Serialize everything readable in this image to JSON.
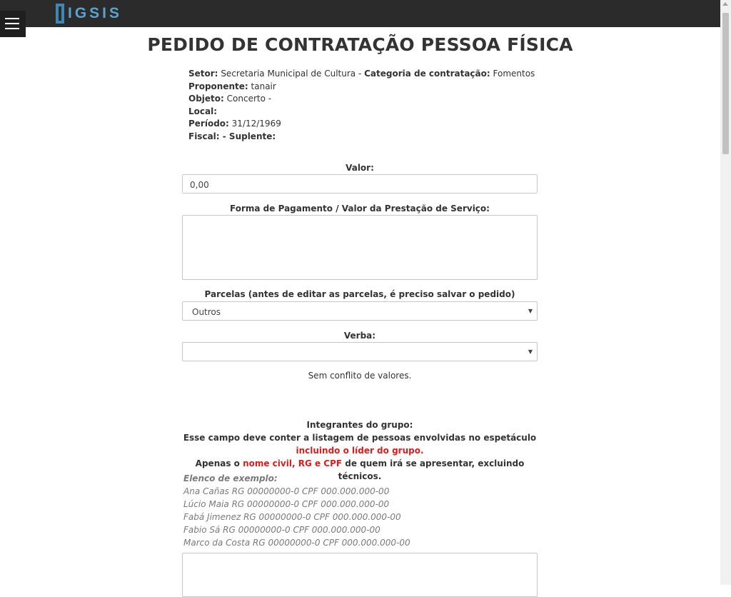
{
  "header": {
    "logo_text": "IGSIS"
  },
  "page": {
    "title": "PEDIDO DE CONTRATAÇÃO PESSOA FÍSICA"
  },
  "info": {
    "setor_label": "Setor:",
    "setor_value": "Secretaria Municipal de Cultura - ",
    "categoria_label": "Categoria de contratação:",
    "categoria_value": "Fomentos",
    "proponente_label": "Proponente:",
    "proponente_value": "tanair",
    "objeto_label": "Objeto:",
    "objeto_value": "Concerto -",
    "local_label": "Local:",
    "periodo_label": "Período:",
    "periodo_value": "31/12/1969",
    "fiscal_label": "Fiscal:",
    "fiscal_sep": " - ",
    "suplente_label": "Suplente:"
  },
  "form": {
    "valor_label": "Valor:",
    "valor_value": "0,00",
    "pagamento_label": "Forma de Pagamento / Valor da Prestação de Serviço:",
    "parcelas_label": "Parcelas (antes de editar as parcelas, é preciso salvar o pedido)",
    "parcelas_selected": "Outros",
    "verba_label": "Verba:",
    "verba_selected": "",
    "conflict_text": "Sem conflito de valores."
  },
  "group": {
    "title": "Integrantes do grupo:",
    "line1_a": "Esse campo deve conter a listagem de pessoas envolvidas no espetáculo ",
    "line1_red": "incluindo o líder do grupo",
    "line1_end": ".",
    "line2_a": "Apenas o ",
    "line2_red": "nome civil, RG e CPF",
    "line2_b": " de quem irá se apresentar, excluindo técnicos.",
    "examples_header": "Elenco de exemplo:",
    "examples": [
      "Ana Cañas RG 00000000-0 CPF 000.000.000-00",
      "Lúcio Maia RG 00000000-0 CPF 000.000.000-00",
      "Fabá Jimenez RG 00000000-0 CPF 000.000.000-00",
      "Fabio Sá RG 00000000-0 CPF 000.000.000-00",
      "Marco da Costa RG 00000000-0 CPF 000.000.000-00"
    ]
  },
  "icons": {
    "menu": "hamburger-icon",
    "dropdown": "caret-down-icon"
  }
}
